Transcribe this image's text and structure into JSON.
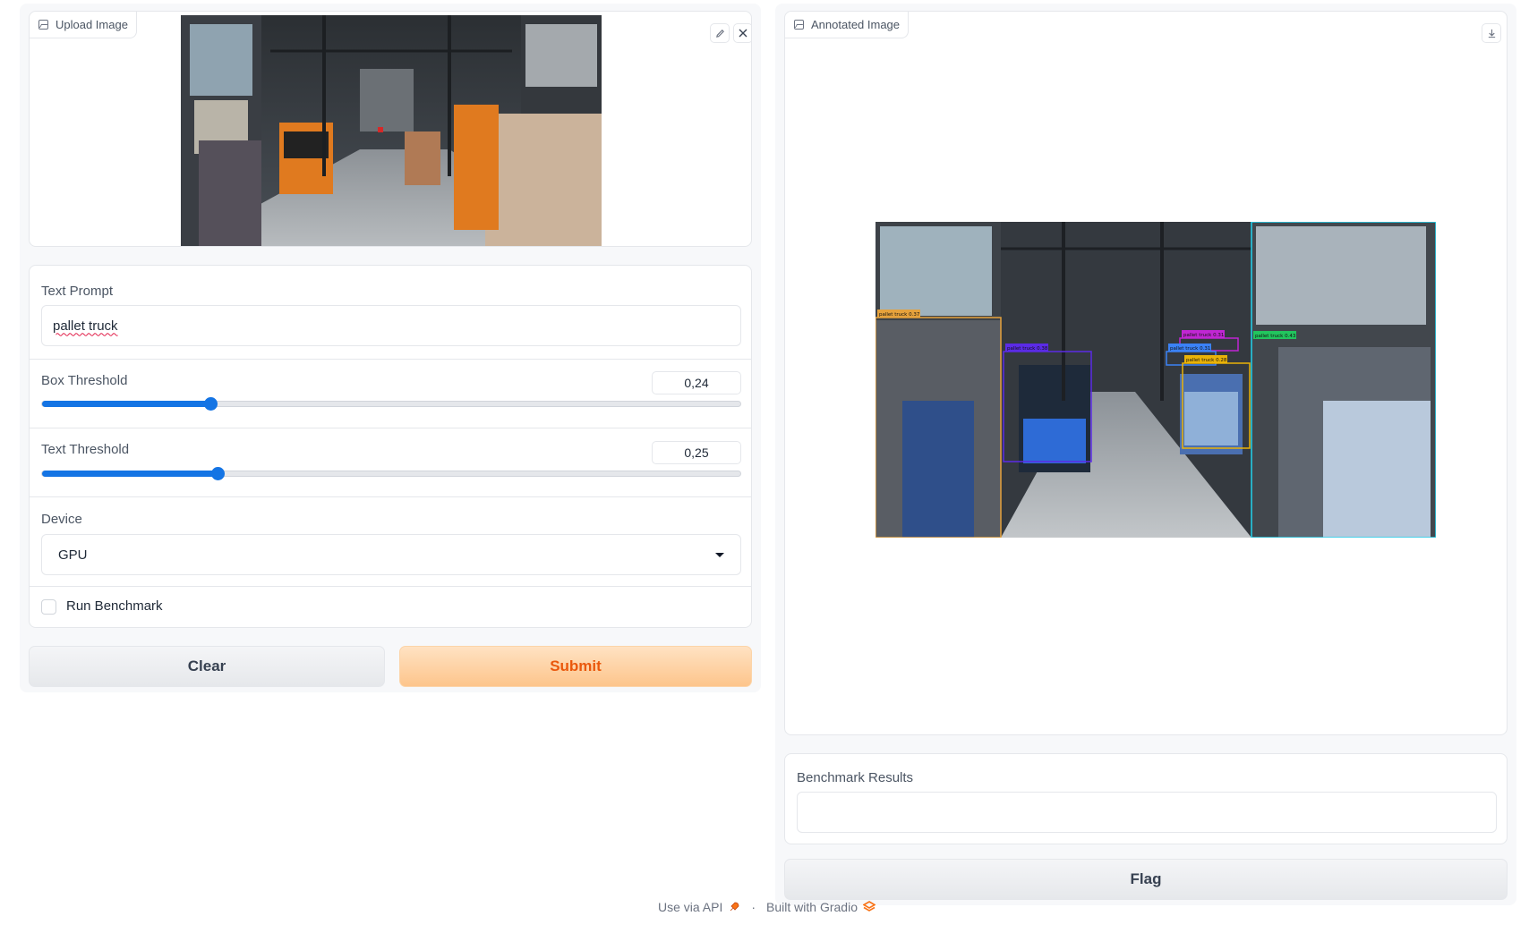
{
  "upload": {
    "label": "Upload Image",
    "edit_icon": "pencil-icon",
    "clear_icon": "close-icon"
  },
  "text_prompt": {
    "label": "Text Prompt",
    "value": "pallet truck"
  },
  "box_threshold": {
    "label": "Box Threshold",
    "value_text": "0,24",
    "value": 0.24
  },
  "text_threshold": {
    "label": "Text Threshold",
    "value_text": "0,25",
    "value": 0.25
  },
  "device": {
    "label": "Device",
    "selected": "GPU"
  },
  "benchmark": {
    "label": "Run Benchmark",
    "checked": false
  },
  "buttons": {
    "clear": "Clear",
    "submit": "Submit",
    "flag": "Flag"
  },
  "annotated": {
    "label": "Annotated Image",
    "download_icon": "download-icon",
    "detections": [
      {
        "label": "pallet truck 0.37",
        "color": "#e6a23c"
      },
      {
        "label": "pallet truck 0.38",
        "color": "#5b2be6"
      },
      {
        "label": "pallet truck 0.31",
        "color": "#c026d3"
      },
      {
        "label": "pallet truck 0.31",
        "color": "#3b82f6"
      },
      {
        "label": "pallet truck 0.28",
        "color": "#eab308"
      },
      {
        "label": "pallet truck 0.43",
        "color": "#22c55e"
      }
    ]
  },
  "benchmark_results": {
    "label": "Benchmark Results",
    "value": ""
  },
  "footer": {
    "api": "Use via API",
    "separator": "·",
    "built": "Built with Gradio"
  },
  "colors": {
    "accent": "#1474e4",
    "primary_text": "#ea580c"
  }
}
